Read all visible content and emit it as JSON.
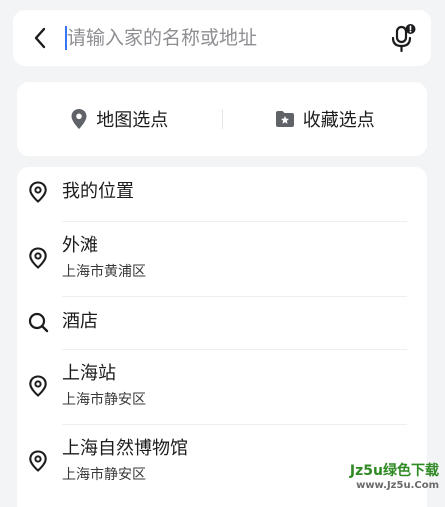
{
  "search": {
    "placeholder": "请输入家的名称或地址",
    "value": ""
  },
  "quick_actions": [
    {
      "label": "地图选点",
      "icon": "map-pin-icon"
    },
    {
      "label": "收藏选点",
      "icon": "star-folder-icon"
    }
  ],
  "list": [
    {
      "title": "我的位置",
      "subtitle": "",
      "icon": "location-pin-icon"
    },
    {
      "title": "外滩",
      "subtitle": "上海市黄浦区",
      "icon": "location-pin-icon"
    },
    {
      "title": "酒店",
      "subtitle": "",
      "icon": "search-icon"
    },
    {
      "title": "上海站",
      "subtitle": "上海市静安区",
      "icon": "location-pin-icon"
    },
    {
      "title": "上海自然博物馆",
      "subtitle": "上海市静安区",
      "icon": "location-pin-icon"
    }
  ],
  "watermark": {
    "main": "Jz5u绿色下载",
    "url": "www.Jz5u.Com"
  },
  "colors": {
    "caret": "#3b74f2",
    "background": "#f3f4f6",
    "card": "#ffffff",
    "watermark": "#2f8a23"
  }
}
